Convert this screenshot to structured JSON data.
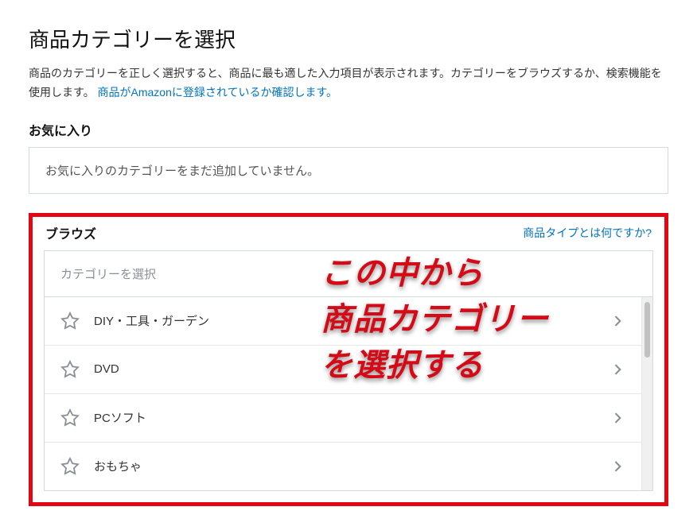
{
  "page_title": "商品カテゴリーを選択",
  "description_1": "商品のカテゴリーを正しく選択すると、商品に最も適した入力項目が表示されます。カテゴリーをブラウズするか、検索機能を使用します。",
  "description_link": "商品がAmazonに登録されているか確認します。",
  "favorites_title": "お気に入り",
  "favorites_empty": "お気に入りのカテゴリーをまだ追加していません。",
  "browse_title": "ブラウズ",
  "help_link": "商品タイプとは何ですか?",
  "search_placeholder": "カテゴリーを選択",
  "categories": [
    {
      "label": "DIY・工具・ガーデン"
    },
    {
      "label": "DVD"
    },
    {
      "label": "PCソフト"
    },
    {
      "label": "おもちゃ"
    }
  ],
  "annotation": {
    "line1": "この中から",
    "line2": "商品カテゴリー",
    "line3": "を選択する"
  }
}
